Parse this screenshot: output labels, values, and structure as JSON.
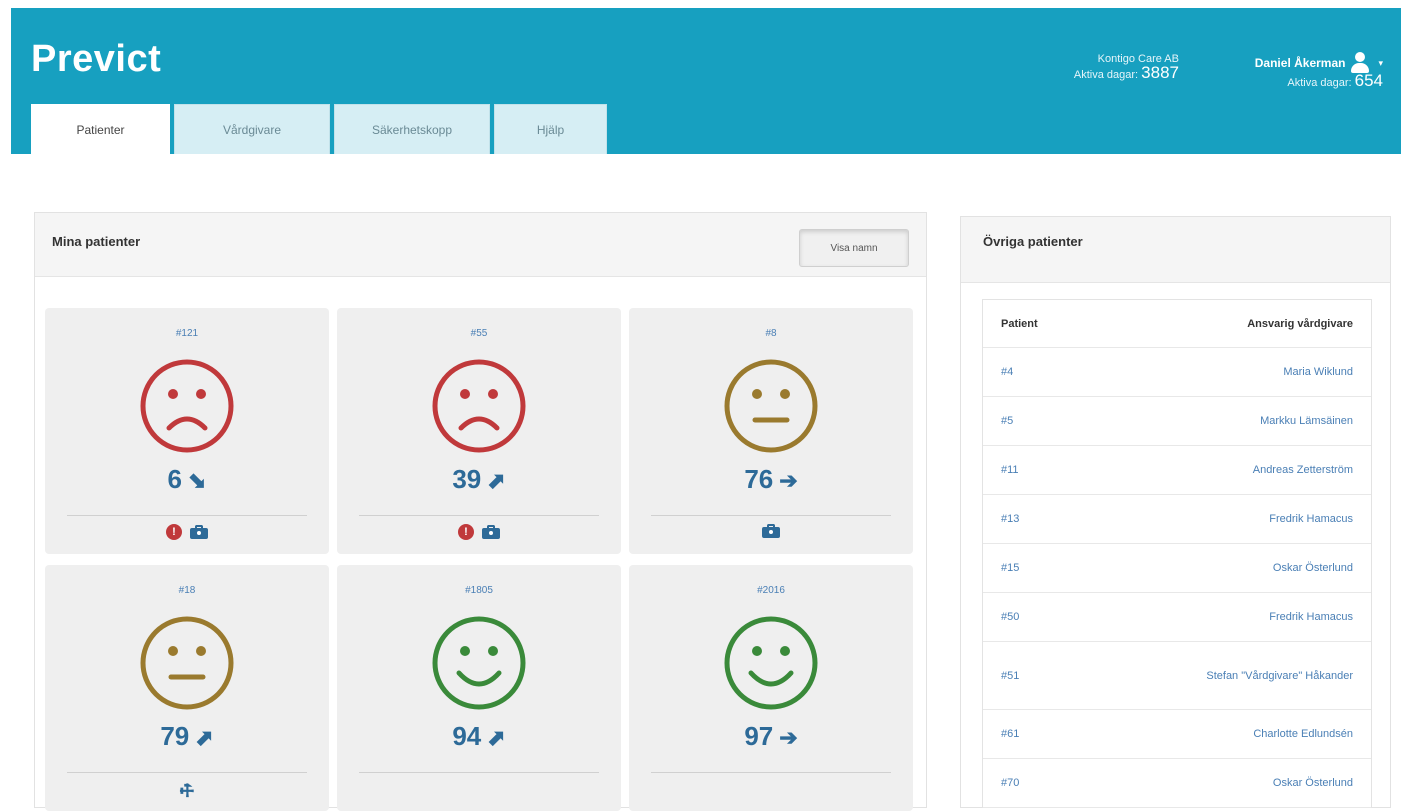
{
  "header": {
    "brand": "Previct",
    "left_info": {
      "line1": "Kontigo Care AB",
      "label2": "Aktiva dagar:",
      "value2": "3887"
    },
    "right_info": {
      "user_name": "Daniel Åkerman",
      "label2": "Aktiva dagar:",
      "value2": "654"
    },
    "tabs": [
      {
        "label": "Patienter",
        "active": true
      },
      {
        "label": "Vårdgivare",
        "active": false
      },
      {
        "label": "Säkerhetskopp",
        "active": false
      },
      {
        "label": "Hjälp",
        "active": false
      }
    ]
  },
  "my_patients": {
    "title": "Mina patienter",
    "toggle_button": "Visa namn",
    "cards": [
      {
        "id": "#121",
        "mood": "sad",
        "color": "#c0393b",
        "score": "6",
        "trend": "down-right",
        "trend_glyph": "⬊",
        "icons": [
          "alert",
          "case"
        ]
      },
      {
        "id": "#55",
        "mood": "sad",
        "color": "#c0393b",
        "score": "39",
        "trend": "up-right",
        "trend_glyph": "⬈",
        "icons": [
          "alert",
          "case"
        ]
      },
      {
        "id": "#8",
        "mood": "neutral",
        "color": "#9a7a2e",
        "score": "76",
        "trend": "right",
        "trend_glyph": "➔",
        "icons": [
          "case"
        ]
      },
      {
        "id": "#18",
        "mood": "neutral",
        "color": "#9a7a2e",
        "score": "79",
        "trend": "up-right",
        "trend_glyph": "⬈",
        "icons": [
          "wrench"
        ]
      },
      {
        "id": "#1805",
        "mood": "happy",
        "color": "#3a8a3a",
        "score": "94",
        "trend": "up-right",
        "trend_glyph": "⬈",
        "icons": []
      },
      {
        "id": "#2016",
        "mood": "happy",
        "color": "#3a8a3a",
        "score": "97",
        "trend": "right",
        "trend_glyph": "➔",
        "icons": []
      }
    ]
  },
  "other_patients": {
    "title": "Övriga patienter",
    "columns": [
      "Patient",
      "Ansvarig vårdgivare"
    ],
    "rows": [
      {
        "patient": "#4",
        "caregiver": "Maria Wiklund"
      },
      {
        "patient": "#5",
        "caregiver": "Markku Lämsäinen"
      },
      {
        "patient": "#11",
        "caregiver": "Andreas Zetterström"
      },
      {
        "patient": "#13",
        "caregiver": "Fredrik Hamacus"
      },
      {
        "patient": "#15",
        "caregiver": "Oskar Österlund"
      },
      {
        "patient": "#50",
        "caregiver": "Fredrik Hamacus"
      },
      {
        "patient": "#51",
        "caregiver": "Stefan \"Vårdgivare\" Håkander"
      },
      {
        "patient": "#61",
        "caregiver": "Charlotte Edlundsén"
      },
      {
        "patient": "#70",
        "caregiver": "Oskar Österlund"
      }
    ]
  }
}
